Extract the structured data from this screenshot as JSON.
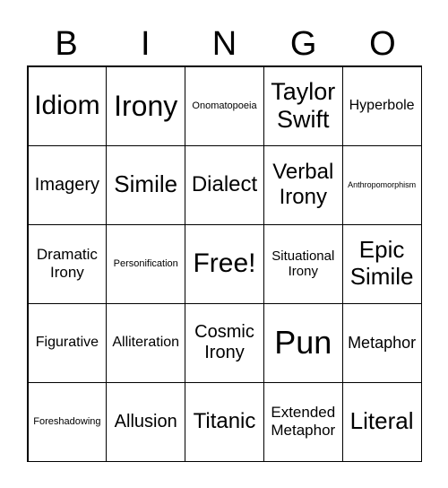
{
  "header": [
    "B",
    "I",
    "N",
    "G",
    "O"
  ],
  "cells": [
    "Idiom",
    "Irony",
    "Onomatopoeia",
    "Taylor Swift",
    "Hyperbole",
    "Imagery",
    "Simile",
    "Dialect",
    "Verbal Irony",
    "Anthropomorphism",
    "Dramatic Irony",
    "Personification",
    "Free!",
    "Situational Irony",
    "Epic Simile",
    "Figurative",
    "Alliteration",
    "Cosmic Irony",
    "Pun",
    "Metaphor",
    "Foreshadowing",
    "Allusion",
    "Titanic",
    "Extended Metaphor",
    "Literal"
  ]
}
